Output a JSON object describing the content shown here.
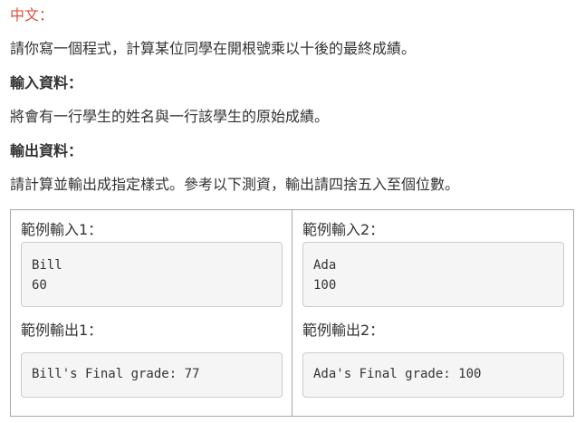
{
  "language_label": "中文：",
  "description": "請你寫一個程式，計算某位同學在開根號乘以十後的最終成績。",
  "input_heading": "輸入資料：",
  "input_description": "將會有一行學生的姓名與一行該學生的原始成績。",
  "output_heading": "輸出資料：",
  "output_description": "請計算並輸出成指定樣式。參考以下測資，輸出請四捨五入至個位數。",
  "examples": [
    {
      "input_label": "範例輸入1：",
      "input_lines": [
        "Bill",
        "60"
      ],
      "output_label": "範例輸出1：",
      "output_lines": [
        "Bill's Final grade: 77"
      ]
    },
    {
      "input_label": "範例輸入2：",
      "input_lines": [
        "Ada",
        "100"
      ],
      "output_label": "範例輸出2：",
      "output_lines": [
        "Ada's Final grade: 100"
      ]
    }
  ]
}
